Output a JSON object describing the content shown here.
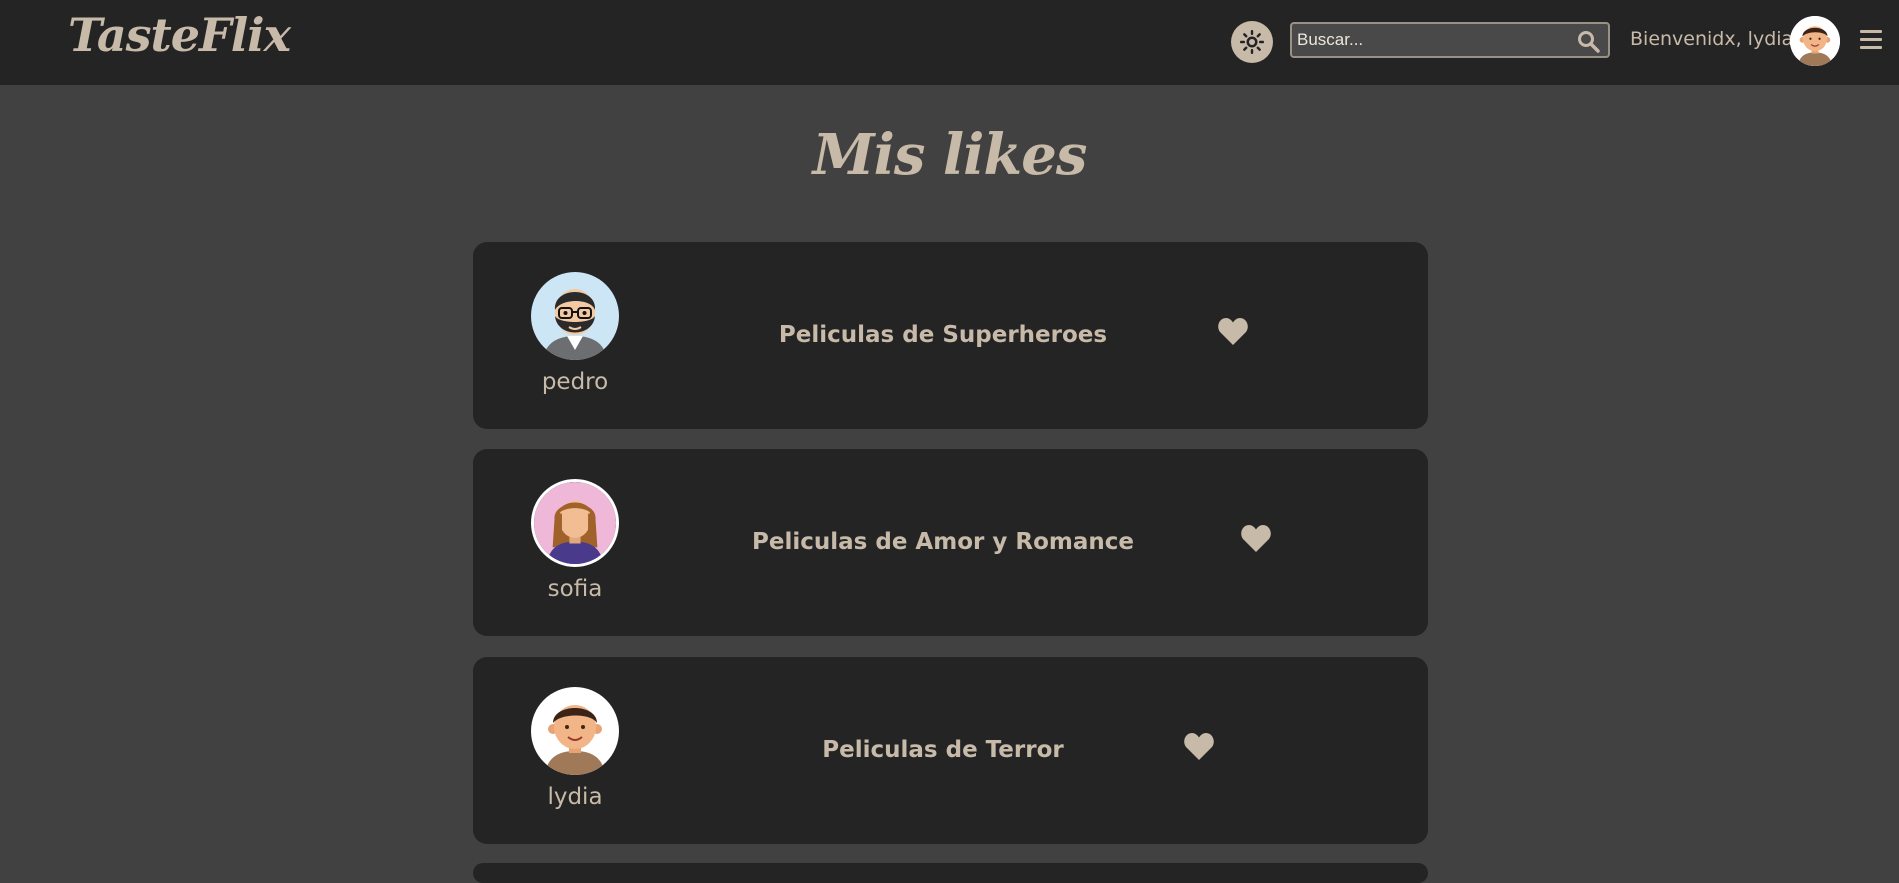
{
  "app": {
    "logo": "TasteFlix"
  },
  "header": {
    "search_placeholder": "Buscar...",
    "welcome": "Bienvenidx, lydia"
  },
  "page": {
    "title": "Mis likes"
  },
  "likes": [
    {
      "user": "pedro",
      "list": "Peliculas de Superheroes",
      "avatar": "avatar-bearded-man"
    },
    {
      "user": "sofia",
      "list": "Peliculas de Amor y Romance",
      "avatar": "avatar-woman"
    },
    {
      "user": "lydia",
      "list": "Peliculas de Terror",
      "avatar": "avatar-young-man"
    }
  ],
  "icons": {
    "theme": "sun-icon",
    "search": "search-icon",
    "menu": "hamburger-menu-icon",
    "like": "heart-icon"
  },
  "colors": {
    "background": "#424141",
    "navbar": "#252424",
    "card": "#252424",
    "accent": "#c7baa8"
  }
}
